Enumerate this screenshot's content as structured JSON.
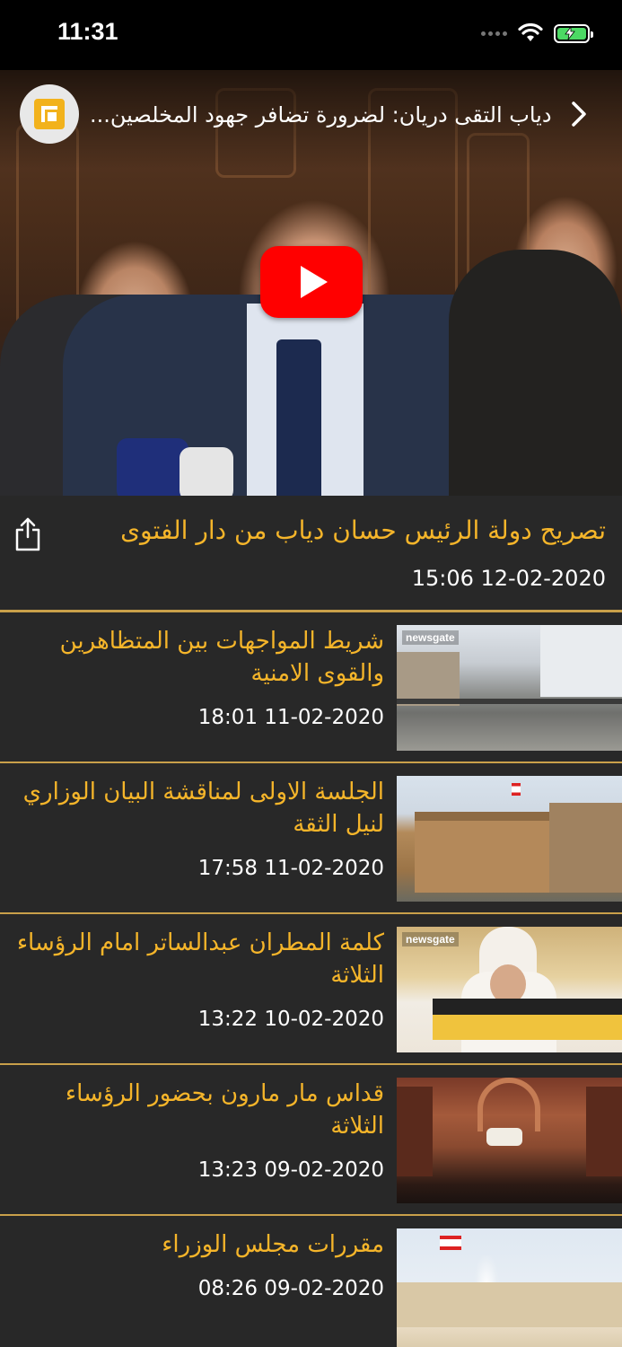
{
  "status_bar": {
    "time": "11:31"
  },
  "video": {
    "title": "دياب التقى دريان: لضرورة تضافر جهود المخلصين...",
    "channel_brand": "newsgate"
  },
  "featured": {
    "title": "تصريح دولة الرئيس حسان  دياب من دار الفتوى",
    "date": "15:06 12-02-2020"
  },
  "items": [
    {
      "title": "شريط المواجهات بين المتظاهرين والقوى الامنية",
      "date": "18:01 11-02-2020",
      "thumb_brand": "newsgate"
    },
    {
      "title": "الجلسة الاولى لمناقشة البيان الوزاري لنيل الثقة",
      "date": "17:58 11-02-2020"
    },
    {
      "title": "كلمة المطران عبدالساتر امام الرؤساء الثلاثة",
      "date": "13:22 10-02-2020",
      "thumb_brand": "newsgate"
    },
    {
      "title": "قداس مار مارون بحضور الرؤساء الثلاثة",
      "date": "13:23 09-02-2020"
    },
    {
      "title": "مقررات مجلس الوزراء",
      "date": "08:26 09-02-2020"
    }
  ],
  "icons": {
    "signal": "cellular-signal-icon",
    "wifi": "wifi-icon",
    "battery": "battery-charging-icon",
    "chevron": "chevron-right-icon",
    "share": "share-icon",
    "play": "youtube-play-icon"
  },
  "colors": {
    "accent": "#f5b52a",
    "separator": "#c9a04a",
    "row_bg": "#282828",
    "play": "#ff0000"
  }
}
